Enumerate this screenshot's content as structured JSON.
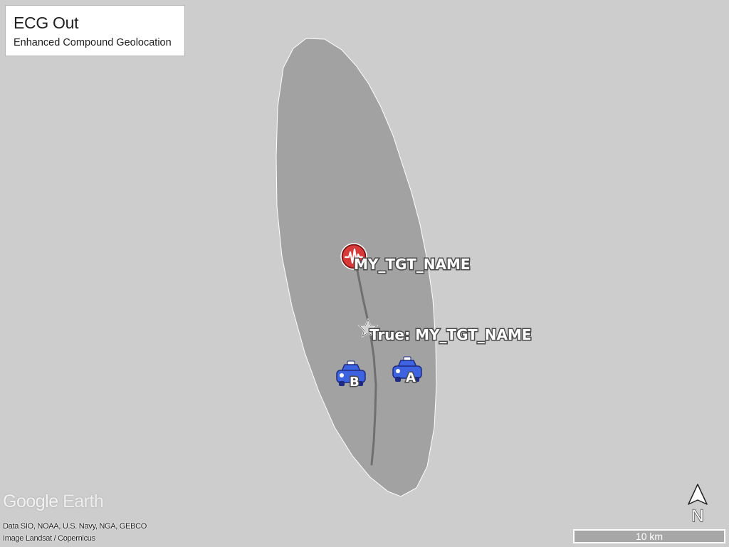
{
  "info_box": {
    "title": "ECG Out",
    "subtitle": "Enhanced Compound Geolocation"
  },
  "placemarks": {
    "target": {
      "label": "MY_TGT_NAME",
      "icon": "seismic-target-icon",
      "color": "#d83a3a"
    },
    "true_location": {
      "label": "True: MY_TGT_NAME",
      "icon": "star-icon"
    },
    "vehicle_a": {
      "letter": "A",
      "icon": "car-icon",
      "color": "#3d63e0"
    },
    "vehicle_b": {
      "letter": "B",
      "icon": "car-icon",
      "color": "#3d63e0"
    }
  },
  "watermark": {
    "google": "Google",
    "earth": "Earth"
  },
  "attribution": {
    "data": "Data SIO, NOAA, U.S. Navy, NGA, GEBCO",
    "imagery": "Image Landsat / Copernicus"
  },
  "scale_bar": {
    "label": "10 km"
  },
  "compass": {
    "label": "N",
    "icon": "north-arrow-icon"
  },
  "colors": {
    "background": "#cdcdcd",
    "ellipse_fill": "#a2a2a2",
    "track_line": "#6f6f6f"
  }
}
